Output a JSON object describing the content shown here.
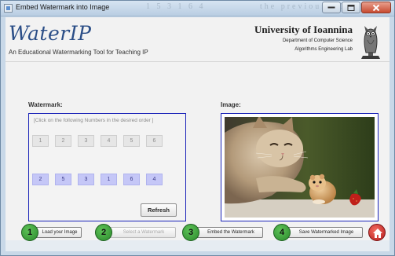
{
  "window": {
    "title": "Embed Watermark into Image",
    "ghost_left": "1 5 3 1 6 4",
    "ghost_right": "the previous 2D supp",
    "controls": [
      "minimize",
      "maximize",
      "close"
    ]
  },
  "header": {
    "logo": "WaterIP",
    "subtitle": "An Educational Watermarking Tool for Teaching IP",
    "university": "University of Ioannina",
    "department": "Department of Computer Science",
    "lab": "Algorithms Engineering Lab",
    "emblem_icon": "owl-icon"
  },
  "watermark": {
    "label": "Watermark:",
    "instruction": "[Click on the following Numbers in the desired order ]",
    "available_numbers": [
      "1",
      "2",
      "3",
      "4",
      "5",
      "6"
    ],
    "selected_order": [
      "2",
      "5",
      "3",
      "1",
      "6",
      "4"
    ],
    "refresh_label": "Refresh"
  },
  "image": {
    "label": "Image:",
    "content": "cat-and-hamster-photo"
  },
  "steps": [
    {
      "number": "1",
      "label": "Load your Image",
      "enabled": true
    },
    {
      "number": "2",
      "label": "Select a Watermark",
      "enabled": false
    },
    {
      "number": "3",
      "label": "Embed the Watermark",
      "enabled": true
    },
    {
      "number": "4",
      "label": "Save Watermarked Image",
      "enabled": true
    }
  ],
  "home_icon": "home-icon",
  "colors": {
    "panel_border": "#1a23b8",
    "step_circle": "#3aa03a",
    "selected_number_bg": "#c5c7f7",
    "logo": "#2b4e87",
    "home_button": "#d32f2f"
  }
}
